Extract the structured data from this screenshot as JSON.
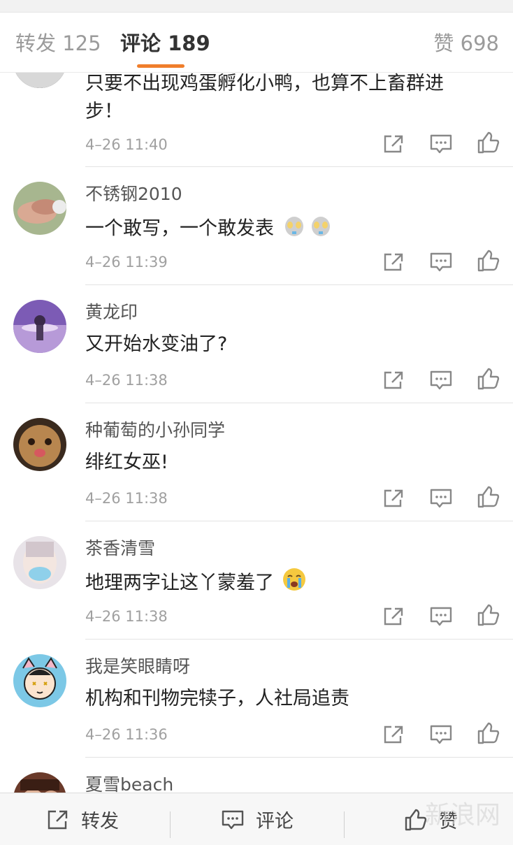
{
  "tabs": {
    "repost_label": "转发 125",
    "comment_label": "评论 189",
    "like_label": "赞 698"
  },
  "comments": [
    {
      "user": "",
      "text": "只要不出现鸡蛋孵化小鸭，也算不上畜群进",
      "text2": "步！",
      "time": "4–26 11:40"
    },
    {
      "user": "不锈钢2010",
      "text": "一个敢写，一个敢发表",
      "time": "4–26 11:39",
      "emoji": "ultraman-emoji"
    },
    {
      "user": "黄龙印",
      "text": "又开始水变油了?",
      "time": "4–26 11:38"
    },
    {
      "user": "种葡萄的小孙同学",
      "text": "绯红女巫!",
      "time": "4–26 11:38"
    },
    {
      "user": "茶香清雪",
      "text": "地理两字让这丫蒙羞了",
      "time": "4–26 11:38",
      "emoji": "crying-emoji"
    },
    {
      "user": "我是笑眼睛呀",
      "text": "机构和刊物完犊子，人社局追责",
      "time": "4–26 11:36"
    },
    {
      "user": "夏雪beach",
      "text": "",
      "time": ""
    }
  ],
  "bottom_bar": {
    "repost_label": "转发",
    "comment_label": "评论",
    "like_label": "赞",
    "watermark": "新浪网"
  },
  "colors": {
    "accent": "#f07e2b",
    "meta_gray": "#a0a0a0"
  }
}
